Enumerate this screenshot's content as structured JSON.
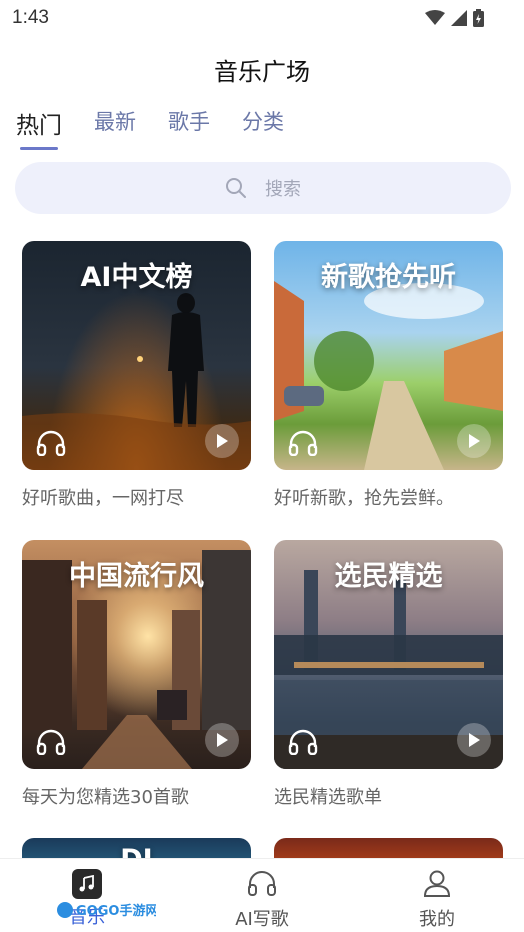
{
  "status_bar": {
    "time": "1:43"
  },
  "header": {
    "title": "音乐广场"
  },
  "tabs": [
    {
      "label": "热门",
      "active": true
    },
    {
      "label": "最新",
      "active": false
    },
    {
      "label": "歌手",
      "active": false
    },
    {
      "label": "分类",
      "active": false
    }
  ],
  "search": {
    "placeholder": "搜索"
  },
  "cards": [
    {
      "title": "AI中文榜",
      "description": "好听歌曲，一网打尽"
    },
    {
      "title": "新歌抢先听",
      "description": "好听新歌，抢先尝鲜。"
    },
    {
      "title": "中国流行风",
      "description": "每天为您精选30首歌"
    },
    {
      "title": "选民精选",
      "description": "选民精选歌单"
    },
    {
      "title": "DJ",
      "description": ""
    },
    {
      "title": "",
      "description": ""
    }
  ],
  "bottom_nav": [
    {
      "label": "音乐",
      "icon": "music-note-icon",
      "active": true
    },
    {
      "label": "AI写歌",
      "icon": "headphone-icon",
      "active": false
    },
    {
      "label": "我的",
      "icon": "user-icon",
      "active": false
    }
  ],
  "watermark": {
    "text": "GOGO手游网"
  },
  "colors": {
    "accent": "#6b78c9",
    "tab_inactive": "#6b78a8",
    "search_bg": "#eef0fb"
  }
}
